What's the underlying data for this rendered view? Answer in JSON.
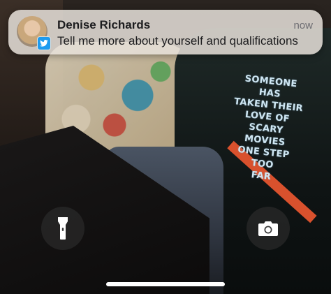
{
  "notification": {
    "sender": "Denise Richards",
    "time": "now",
    "message": "Tell me more about yourself and qualifications",
    "app_icon": "twitter-bird-icon",
    "avatar_icon": "contact-avatar"
  },
  "wallpaper": {
    "print_lines": [
      "SOMEONE HAS",
      "TAKEN THEIR",
      "LOVE OF",
      "SCARY MOVIES",
      "ONE STEP",
      "TOO",
      "FAR"
    ]
  },
  "controls": {
    "flashlight_icon": "flashlight-icon",
    "camera_icon": "camera-icon"
  },
  "colors": {
    "notification_bg": "#e6e1da",
    "app_badge": "#1d9bf0",
    "button_bg": "#282828",
    "home_indicator": "#ffffff"
  }
}
